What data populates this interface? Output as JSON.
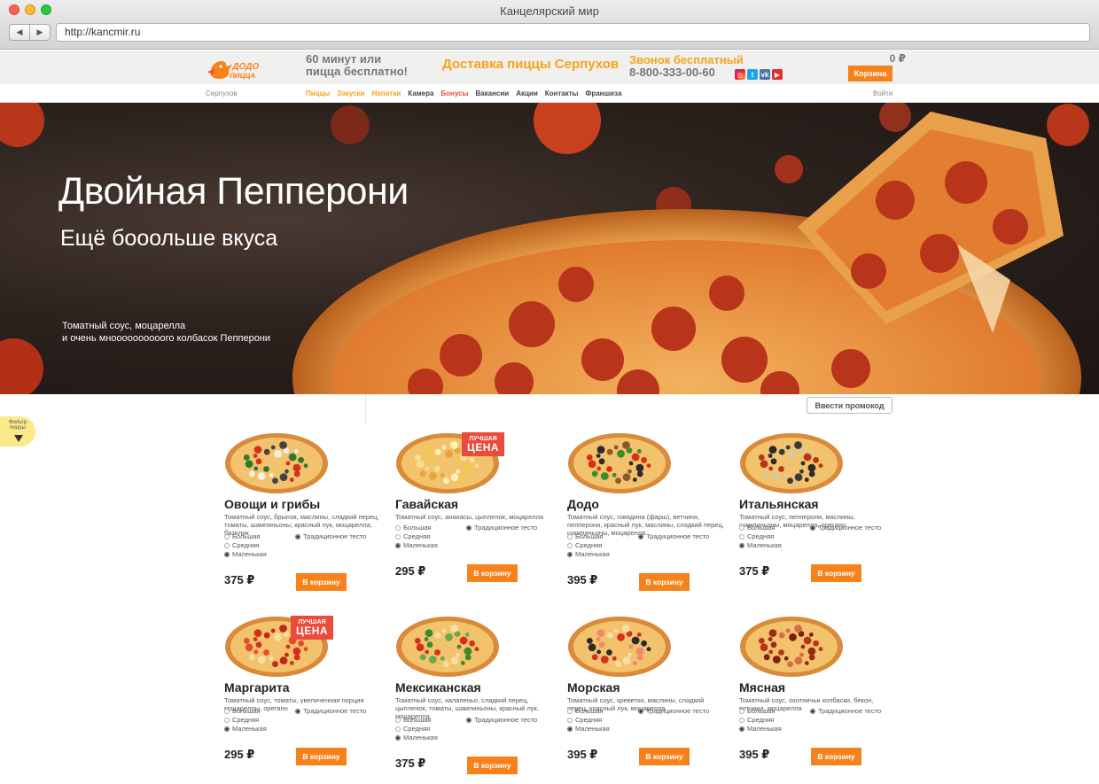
{
  "browser": {
    "window_title": "Канцелярский мир",
    "url": "http://kancmir.ru",
    "back": "◀",
    "forward": "▶"
  },
  "header": {
    "logo_text": "ДОДО ПИЦЦА",
    "promo": "60 минут или пицца бесплатно!",
    "delivery": "Доставка пиццы Серпухов",
    "call_label": "Звонок бесплатный",
    "phone": "8-800-333-00-60",
    "socials": [
      "instagram-icon",
      "twitter-icon",
      "vk-icon",
      "youtube-icon"
    ],
    "cart_sum": "0 ₽",
    "cart_button": "Корзина"
  },
  "nav": {
    "city": "Серпухов",
    "items": [
      {
        "label": "Пиццы",
        "color": "#f7a21b"
      },
      {
        "label": "Закуски",
        "color": "#f7a21b"
      },
      {
        "label": "Напитки",
        "color": "#f7a21b"
      },
      {
        "label": "Камера",
        "color": "#444444"
      },
      {
        "label": "Бонусы",
        "color": "#e94b3c"
      },
      {
        "label": "Вакансии",
        "color": "#444444"
      },
      {
        "label": "Акции",
        "color": "#444444"
      },
      {
        "label": "Контакты",
        "color": "#444444"
      },
      {
        "label": "Франшиза",
        "color": "#444444"
      }
    ],
    "login": "Войти"
  },
  "hero": {
    "title": "Двойная Пепперони",
    "subtitle": "Ещё бооольше вкуса",
    "desc_line1": "Томатный соус, моцарелла",
    "desc_line2": "и очень мноооооооооого колбасок Пепперони",
    "prev": "‹",
    "next": "›"
  },
  "promo_button": "Ввести промокод",
  "filter_label": "Фильтр пиццы",
  "labels": {
    "size_large": "Большая",
    "size_medium": "Средняя",
    "size_small": "Маленькая",
    "dough": "Традиционное тесто",
    "buy": "В корзину",
    "badge_line1": "ЛУЧШАЯ",
    "badge_line2": "ЦЕНА"
  },
  "products": [
    {
      "name": "Овощи и грибы",
      "desc": "Томатный соус, брынза, маслины, сладкий перец, томаты, шампиньоны, красный лук, моцарелла, базилик",
      "price": "375 ₽",
      "badge": false,
      "topping": "veg"
    },
    {
      "name": "Гавайская",
      "desc": "Томатный соус, ананасы, цыпленок, моцарелла",
      "price": "295 ₽",
      "badge": true,
      "topping": "hawaii"
    },
    {
      "name": "Додо",
      "desc": "Томатный соус, говядина (фарш), ветчина, пепперони, красный лук, маслины, сладкий перец, шампиньоны, моцарелла",
      "price": "395 ₽",
      "badge": false,
      "topping": "dodo"
    },
    {
      "name": "Итальянская",
      "desc": "Томатный соус, пепперони, маслины, шампиньоны, моцарелла, орегано",
      "price": "375 ₽",
      "badge": false,
      "topping": "italian"
    },
    {
      "name": "Маргарита",
      "desc": "Томатный соус, томаты, увеличенная порция моцареллы, орегано",
      "price": "295 ₽",
      "badge": true,
      "topping": "margarita"
    },
    {
      "name": "Мексиканская",
      "desc": "Томатный соус, халапеньо, сладкий перец, цыпленок, томаты, шампиньоны, красный лук, моцарелла",
      "price": "375 ₽",
      "badge": false,
      "topping": "mexican"
    },
    {
      "name": "Морская",
      "desc": "Томатный соус, креветки, маслины, сладкий перец, красный лук, моцарелла",
      "price": "395 ₽",
      "badge": false,
      "topping": "sea"
    },
    {
      "name": "Мясная",
      "desc": "Томатный соус, охотничьи колбаски, бекон, ветчина, моцарелла",
      "price": "395 ₽",
      "badge": false,
      "topping": "meat"
    }
  ]
}
